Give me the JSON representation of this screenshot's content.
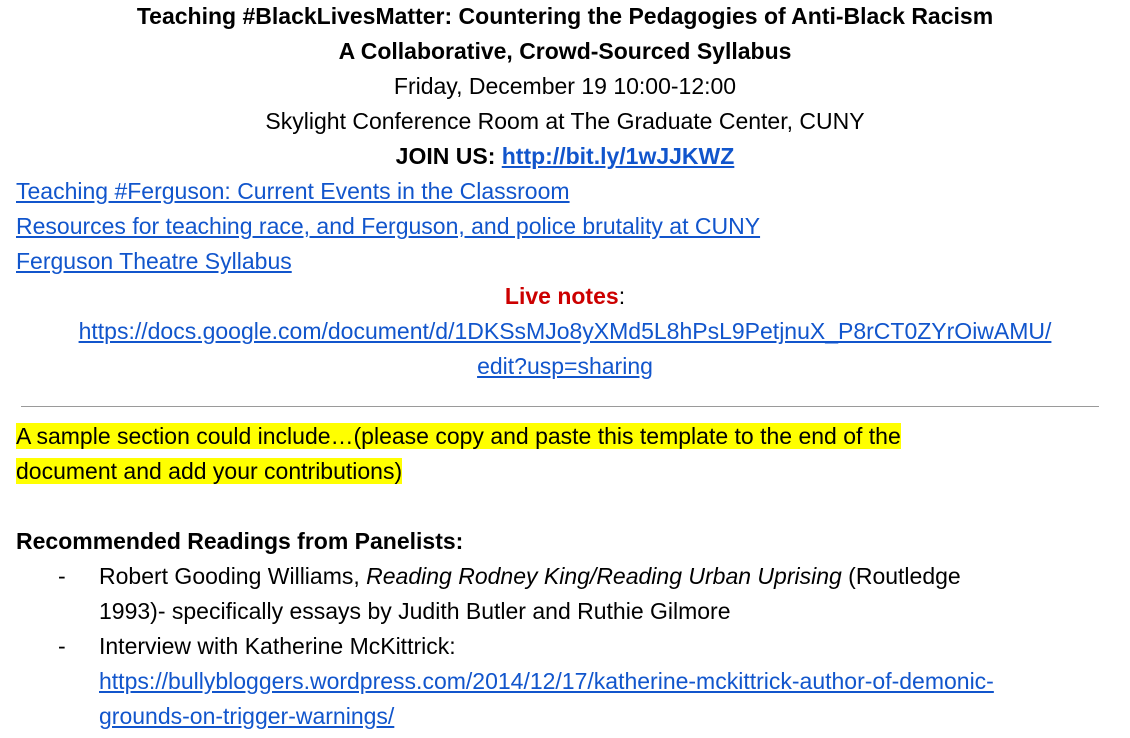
{
  "header": {
    "title": "Teaching #BlackLivesMatter: Countering the Pedagogies of Anti-Black Racism",
    "subtitle": "A Collaborative, Crowd-Sourced Syllabus",
    "date": "Friday, December 19 10:00-12:00",
    "location": "Skylight Conference Room at The Graduate Center, CUNY",
    "join_label": "JOIN US:",
    "join_link": "http://bit.ly/1wJJKWZ"
  },
  "links": [
    "Teaching #Ferguson: Current Events in the Classroom",
    "Resources for teaching race, and Ferguson, and police brutality at CUNY",
    "Ferguson Theatre Syllabus"
  ],
  "live_notes": {
    "label": "Live notes",
    "colon": ":",
    "url_line1": "https://docs.google.com/document/d/1DKSsMJo8yXMd5L8hPsL9PetjnuX_P8rCT0ZYrOiwAMU/",
    "url_line2": "edit?usp=sharing"
  },
  "highlight": {
    "line1": "A sample section could include…(please copy and paste this template to the end of the",
    "line2": "document and add your contributions)"
  },
  "readings": {
    "heading": "Recommended Readings from Panelists:",
    "bullet_char": "-",
    "item1": {
      "author": "Robert Gooding Williams, ",
      "title": "Reading Rodney King/Reading Urban Uprising",
      "rest": " (Routledge",
      "line2": "1993)- specifically essays by Judith Butler and Ruthie Gilmore"
    },
    "item2": {
      "text": "Interview with Katherine McKittrick:",
      "url_line1": "https://bullybloggers.wordpress.com/2014/12/17/katherine-mckittrick-author-of-demonic-",
      "url_line2": "grounds-on-trigger-warnings/"
    }
  }
}
